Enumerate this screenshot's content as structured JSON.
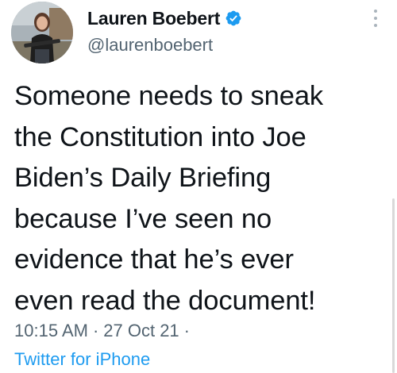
{
  "author": {
    "display_name": "Lauren Boebert",
    "handle": "@laurenboebert",
    "verified": true
  },
  "tweet": {
    "text_lines": [
      "Someone needs to sneak",
      "the Constitution into Joe",
      "Biden’s Daily Briefing",
      "because I’ve seen no",
      "evidence that he’s ever",
      "even read the document!"
    ],
    "time": "10:15 AM",
    "date": "27 Oct 21",
    "separator": "·",
    "source": "Twitter for iPhone"
  },
  "colors": {
    "verified_blue": "#1d9bf0",
    "secondary_text": "#536471",
    "link": "#1d9bf0"
  },
  "icons": {
    "verified": "verified-badge-icon",
    "more": "more-options-icon"
  }
}
